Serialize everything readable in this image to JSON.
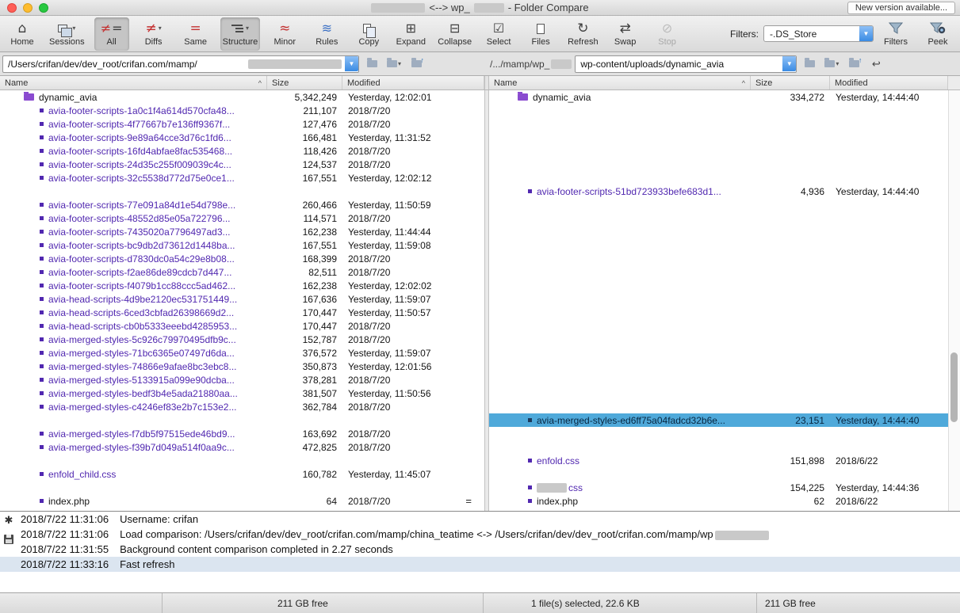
{
  "window": {
    "title_mid": "<--> wp_",
    "title_suffix": "- Folder Compare",
    "new_version_button": "New version available..."
  },
  "toolbar": {
    "buttons": [
      {
        "name": "home",
        "label": "Home",
        "icon": "home-icon"
      },
      {
        "name": "sessions",
        "label": "Sessions",
        "icon": "sessions-icon",
        "dropdown": true
      },
      {
        "name": "all",
        "label": "All",
        "icon": "all-icon",
        "selected": true
      },
      {
        "name": "diffs",
        "label": "Diffs",
        "icon": "diffs-icon",
        "dropdown": true
      },
      {
        "name": "same",
        "label": "Same",
        "icon": "same-icon"
      },
      {
        "name": "structure",
        "label": "Structure",
        "icon": "structure-icon",
        "selected": true,
        "dropdown": true
      },
      {
        "name": "minor",
        "label": "Minor",
        "icon": "minor-icon"
      },
      {
        "name": "rules",
        "label": "Rules",
        "icon": "rules-icon"
      },
      {
        "name": "copy",
        "label": "Copy",
        "icon": "copy-icon"
      },
      {
        "name": "expand",
        "label": "Expand",
        "icon": "expand-icon"
      },
      {
        "name": "collapse",
        "label": "Collapse",
        "icon": "collapse-icon"
      },
      {
        "name": "select",
        "label": "Select",
        "icon": "select-icon"
      },
      {
        "name": "files",
        "label": "Files",
        "icon": "files-icon"
      },
      {
        "name": "refresh",
        "label": "Refresh",
        "icon": "refresh-icon"
      },
      {
        "name": "swap",
        "label": "Swap",
        "icon": "swap-icon"
      },
      {
        "name": "stop",
        "label": "Stop",
        "icon": "stop-icon",
        "disabled": true
      }
    ],
    "filters_label": "Filters:",
    "filters_value": "-.DS_Store",
    "right_buttons": [
      {
        "name": "filters",
        "label": "Filters",
        "icon": "funnel-icon"
      },
      {
        "name": "peek",
        "label": "Peek",
        "icon": "peek-icon"
      }
    ]
  },
  "paths": {
    "left_visible": "/Users/crifan/dev/dev_root/crifan.com/mamp/",
    "right_base_visible": "/.../mamp/wp_",
    "right_relative": "wp-content/uploads/dynamic_avia"
  },
  "columns": {
    "name": "Name",
    "size": "Size",
    "modified": "Modified"
  },
  "rows": [
    {
      "left": {
        "type": "folder",
        "name": "dynamic_avia",
        "size": "5,342,249",
        "modified": "Yesterday, 12:02:01"
      },
      "right": {
        "type": "folder",
        "name": "dynamic_avia",
        "size": "334,272",
        "modified": "Yesterday, 14:44:40"
      }
    },
    {
      "left": {
        "type": "file",
        "name": "avia-footer-scripts-1a0c1f4a614d570cfa48...",
        "size": "211,107",
        "modified": "2018/7/20"
      },
      "right": null
    },
    {
      "left": {
        "type": "file",
        "name": "avia-footer-scripts-4f77667b7e136ff9367f...",
        "size": "127,476",
        "modified": "2018/7/20"
      },
      "right": null
    },
    {
      "left": {
        "type": "file",
        "name": "avia-footer-scripts-9e89a64cce3d76c1fd6...",
        "size": "166,481",
        "modified": "Yesterday, 11:31:52"
      },
      "right": null
    },
    {
      "left": {
        "type": "file",
        "name": "avia-footer-scripts-16fd4abfae8fac535468...",
        "size": "118,426",
        "modified": "2018/7/20"
      },
      "right": null
    },
    {
      "left": {
        "type": "file",
        "name": "avia-footer-scripts-24d35c255f009039c4c...",
        "size": "124,537",
        "modified": "2018/7/20"
      },
      "right": null
    },
    {
      "left": {
        "type": "file",
        "name": "avia-footer-scripts-32c5538d772d75e0ce1...",
        "size": "167,551",
        "modified": "Yesterday, 12:02:12"
      },
      "right": null
    },
    {
      "left": null,
      "right": {
        "type": "file",
        "name": "avia-footer-scripts-51bd723933befe683d1...",
        "size": "4,936",
        "modified": "Yesterday, 14:44:40"
      }
    },
    {
      "left": {
        "type": "file",
        "name": "avia-footer-scripts-77e091a84d1e54d798e...",
        "size": "260,466",
        "modified": "Yesterday, 11:50:59"
      },
      "right": null
    },
    {
      "left": {
        "type": "file",
        "name": "avia-footer-scripts-48552d85e05a722796...",
        "size": "114,571",
        "modified": "2018/7/20"
      },
      "right": null
    },
    {
      "left": {
        "type": "file",
        "name": "avia-footer-scripts-7435020a7796497ad3...",
        "size": "162,238",
        "modified": "Yesterday, 11:44:44"
      },
      "right": null
    },
    {
      "left": {
        "type": "file",
        "name": "avia-footer-scripts-bc9db2d73612d1448ba...",
        "size": "167,551",
        "modified": "Yesterday, 11:59:08"
      },
      "right": null
    },
    {
      "left": {
        "type": "file",
        "name": "avia-footer-scripts-d7830dc0a54c29e8b08...",
        "size": "168,399",
        "modified": "2018/7/20"
      },
      "right": null
    },
    {
      "left": {
        "type": "file",
        "name": "avia-footer-scripts-f2ae86de89cdcb7d447...",
        "size": "82,511",
        "modified": "2018/7/20"
      },
      "right": null
    },
    {
      "left": {
        "type": "file",
        "name": "avia-footer-scripts-f4079b1cc88ccc5ad462...",
        "size": "162,238",
        "modified": "Yesterday, 12:02:02"
      },
      "right": null
    },
    {
      "left": {
        "type": "file",
        "name": "avia-head-scripts-4d9be2120ec531751449...",
        "size": "167,636",
        "modified": "Yesterday, 11:59:07"
      },
      "right": null
    },
    {
      "left": {
        "type": "file",
        "name": "avia-head-scripts-6ced3cbfad26398669d2...",
        "size": "170,447",
        "modified": "Yesterday, 11:50:57"
      },
      "right": null
    },
    {
      "left": {
        "type": "file",
        "name": "avia-head-scripts-cb0b5333eeebd4285953...",
        "size": "170,447",
        "modified": "2018/7/20"
      },
      "right": null
    },
    {
      "left": {
        "type": "file",
        "name": "avia-merged-styles-5c926c79970495dfb9c...",
        "size": "152,787",
        "modified": "2018/7/20"
      },
      "right": null
    },
    {
      "left": {
        "type": "file",
        "name": "avia-merged-styles-71bc6365e07497d6da...",
        "size": "376,572",
        "modified": "Yesterday, 11:59:07"
      },
      "right": null
    },
    {
      "left": {
        "type": "file",
        "name": "avia-merged-styles-74866e9afae8bc3ebc8...",
        "size": "350,873",
        "modified": "Yesterday, 12:01:56"
      },
      "right": null
    },
    {
      "left": {
        "type": "file",
        "name": "avia-merged-styles-5133915a099e90dcba...",
        "size": "378,281",
        "modified": "2018/7/20"
      },
      "right": null
    },
    {
      "left": {
        "type": "file",
        "name": "avia-merged-styles-bedf3b4e5ada21880aa...",
        "size": "381,507",
        "modified": "Yesterday, 11:50:56"
      },
      "right": null
    },
    {
      "left": {
        "type": "file",
        "name": "avia-merged-styles-c4246ef83e2b7c153e2...",
        "size": "362,784",
        "modified": "2018/7/20"
      },
      "right": null
    },
    {
      "left": null,
      "right": {
        "type": "file",
        "name": "avia-merged-styles-ed6ff75a04fadcd32b6e...",
        "size": "23,151",
        "modified": "Yesterday, 14:44:40",
        "selected": true
      }
    },
    {
      "left": {
        "type": "file",
        "name": "avia-merged-styles-f7db5f97515ede46bd9...",
        "size": "163,692",
        "modified": "2018/7/20"
      },
      "right": null
    },
    {
      "left": {
        "type": "file",
        "name": "avia-merged-styles-f39b7d049a514f0aa9c...",
        "size": "472,825",
        "modified": "2018/7/20"
      },
      "right": null
    },
    {
      "left": null,
      "right": {
        "type": "file",
        "name": "enfold.css",
        "size": "151,898",
        "modified": "2018/6/22"
      }
    },
    {
      "left": {
        "type": "file",
        "name": "enfold_child.css",
        "size": "160,782",
        "modified": "Yesterday, 11:45:07"
      },
      "right": null
    },
    {
      "left": null,
      "right": {
        "type": "file",
        "name": "css",
        "size": "154,225",
        "modified": "Yesterday, 14:44:36",
        "redacted_prefix": true
      }
    },
    {
      "left": {
        "type": "file",
        "name": "index.php",
        "size": "64",
        "modified": "2018/7/20",
        "match": true,
        "compare": "="
      },
      "right": {
        "type": "file",
        "name": "index.php",
        "size": "62",
        "modified": "2018/6/22",
        "match": true
      }
    }
  ],
  "log": {
    "lines": [
      {
        "time": "2018/7/22 11:31:06",
        "text": "Username: crifan"
      },
      {
        "time": "2018/7/22 11:31:06",
        "text": "Load comparison: /Users/crifan/dev/dev_root/crifan.com/mamp/china_teatime <-> /Users/crifan/dev/dev_root/crifan.com/mamp/wp",
        "redacted_suffix": true
      },
      {
        "time": "2018/7/22 11:31:55",
        "text": "Background content comparison completed in 2.27 seconds"
      },
      {
        "time": "2018/7/22 11:33:16",
        "text": "Fast refresh",
        "selected": true
      }
    ]
  },
  "statusbar": {
    "segments": [
      "",
      "211 GB free",
      "1 file(s) selected, 22.6 KB",
      "211 GB free"
    ]
  }
}
